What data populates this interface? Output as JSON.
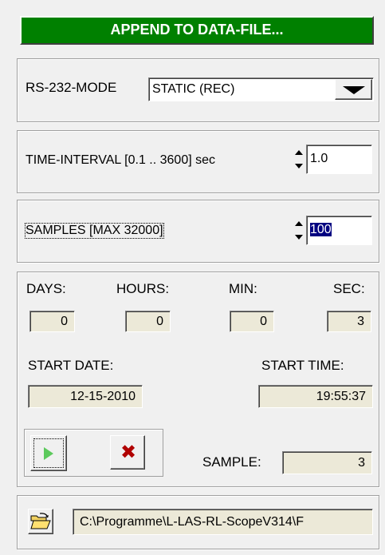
{
  "header": {
    "title": "APPEND TO DATA-FILE...",
    "bg_color": "#008000",
    "text_color": "#ffffff"
  },
  "rs232": {
    "label": "RS-232-MODE",
    "selected": "STATIC (REC)"
  },
  "time_interval": {
    "label": "TIME-INTERVAL [0.1 .. 3600] sec",
    "value": "1.0"
  },
  "samples": {
    "label": "SAMPLES  [MAX 32000]",
    "value": "100"
  },
  "timer": {
    "days_label": "DAYS:",
    "days": "0",
    "hours_label": "HOURS:",
    "hours": "0",
    "min_label": "MIN:",
    "min": "0",
    "sec_label": "SEC:",
    "sec": "3",
    "start_date_label": "START DATE:",
    "start_date": "12-15-2010",
    "start_time_label": "START TIME:",
    "start_time": "19:55:37",
    "sample_label": "SAMPLE:",
    "sample": "3",
    "play_icon": "play-icon",
    "stop_icon": "stop-icon"
  },
  "file": {
    "path": "C:\\Programme\\L-LAS-RL-ScopeV314\\F",
    "icon": "open-folder-icon"
  }
}
